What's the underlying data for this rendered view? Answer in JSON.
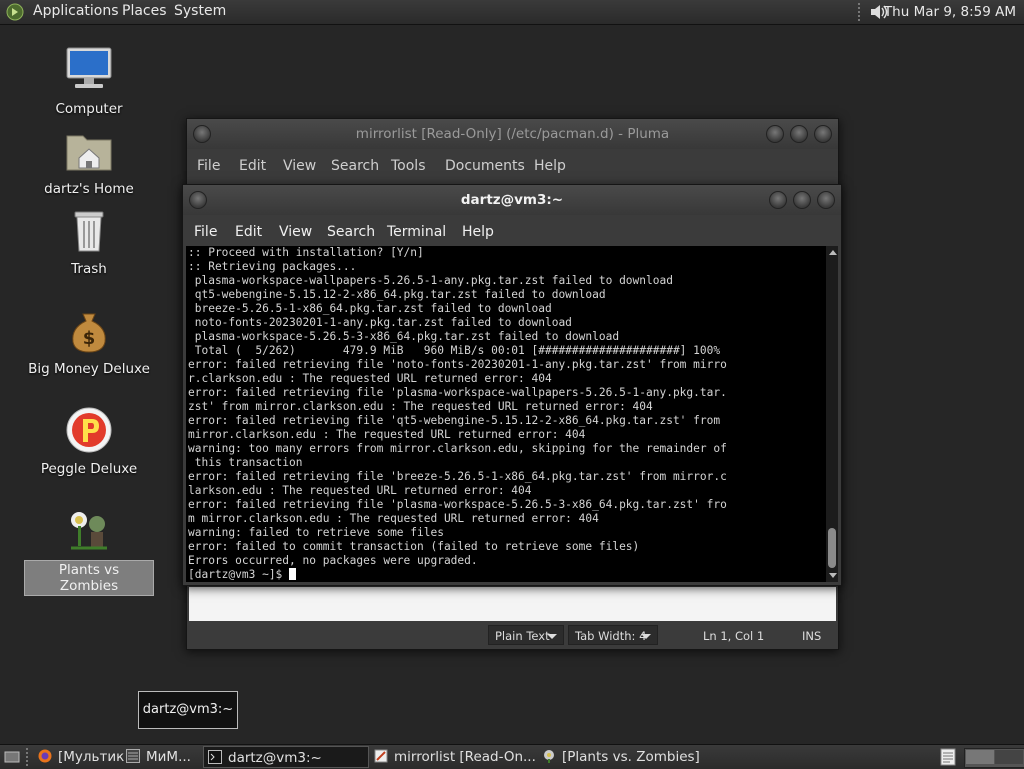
{
  "top_panel": {
    "menus": [
      "Applications",
      "Places",
      "System"
    ],
    "clock": "Thu Mar  9,  8:59 AM",
    "icons": [
      "mate-logo-icon",
      "volume-icon"
    ]
  },
  "desktop_icons": [
    {
      "label": "Computer",
      "icon": "computer-icon"
    },
    {
      "label": "dartz's Home",
      "icon": "home-folder-icon"
    },
    {
      "label": "Trash",
      "icon": "trash-icon"
    },
    {
      "label": "Big Money Deluxe",
      "icon": "money-bag-icon"
    },
    {
      "label": "Peggle Deluxe",
      "icon": "peggle-icon"
    },
    {
      "label": "Plants vs Zombies",
      "icon": "plants-vs-zombies-icon"
    }
  ],
  "pluma": {
    "title": "mirrorlist [Read-Only] (/etc/pacman.d) - Pluma",
    "menu": [
      "File",
      "Edit",
      "View",
      "Search",
      "Tools",
      "Documents",
      "Help"
    ],
    "status": {
      "language": "Plain Text",
      "tab_width": "Tab Width:  4",
      "position": "Ln 1, Col 1",
      "mode": "INS"
    }
  },
  "terminal": {
    "title": "dartz@vm3:~",
    "menu": [
      "File",
      "Edit",
      "View",
      "Search",
      "Terminal",
      "Help"
    ],
    "lines": [
      ":: Proceed with installation? [Y/n]",
      ":: Retrieving packages...",
      " plasma-workspace-wallpapers-5.26.5-1-any.pkg.tar.zst failed to download",
      " qt5-webengine-5.15.12-2-x86_64.pkg.tar.zst failed to download",
      " breeze-5.26.5-1-x86_64.pkg.tar.zst failed to download",
      " noto-fonts-20230201-1-any.pkg.tar.zst failed to download",
      " plasma-workspace-5.26.5-3-x86_64.pkg.tar.zst failed to download",
      " Total (  5/262)       479.9 MiB   960 MiB/s 00:01 [#####################] 100%",
      "error: failed retrieving file 'noto-fonts-20230201-1-any.pkg.tar.zst' from mirro",
      "r.clarkson.edu : The requested URL returned error: 404",
      "error: failed retrieving file 'plasma-workspace-wallpapers-5.26.5-1-any.pkg.tar.",
      "zst' from mirror.clarkson.edu : The requested URL returned error: 404",
      "error: failed retrieving file 'qt5-webengine-5.15.12-2-x86_64.pkg.tar.zst' from ",
      "mirror.clarkson.edu : The requested URL returned error: 404",
      "warning: too many errors from mirror.clarkson.edu, skipping for the remainder of",
      " this transaction",
      "error: failed retrieving file 'breeze-5.26.5-1-x86_64.pkg.tar.zst' from mirror.c",
      "larkson.edu : The requested URL returned error: 404",
      "error: failed retrieving file 'plasma-workspace-5.26.5-3-x86_64.pkg.tar.zst' fro",
      "m mirror.clarkson.edu : The requested URL returned error: 404",
      "warning: failed to retrieve some files",
      "error: failed to commit transaction (failed to retrieve some files)",
      "Errors occurred, no packages were upgraded."
    ],
    "prompt": "[dartz@vm3 ~]$ "
  },
  "tooltip": "dartz@vm3:~",
  "taskbar": {
    "items": [
      {
        "label": "[Мультик",
        "icon": "firefox-icon",
        "active": false
      },
      {
        "label": "МиМ...",
        "icon": "image-viewer-icon",
        "active": false
      },
      {
        "label": "dartz@vm3:~",
        "icon": "terminal-icon",
        "active": true
      },
      {
        "label": "mirrorlist [Read-On...",
        "icon": "text-editor-icon",
        "active": false
      },
      {
        "label": "[Plants vs. Zombies]",
        "icon": "plants-vs-zombies-icon",
        "active": false
      }
    ]
  }
}
